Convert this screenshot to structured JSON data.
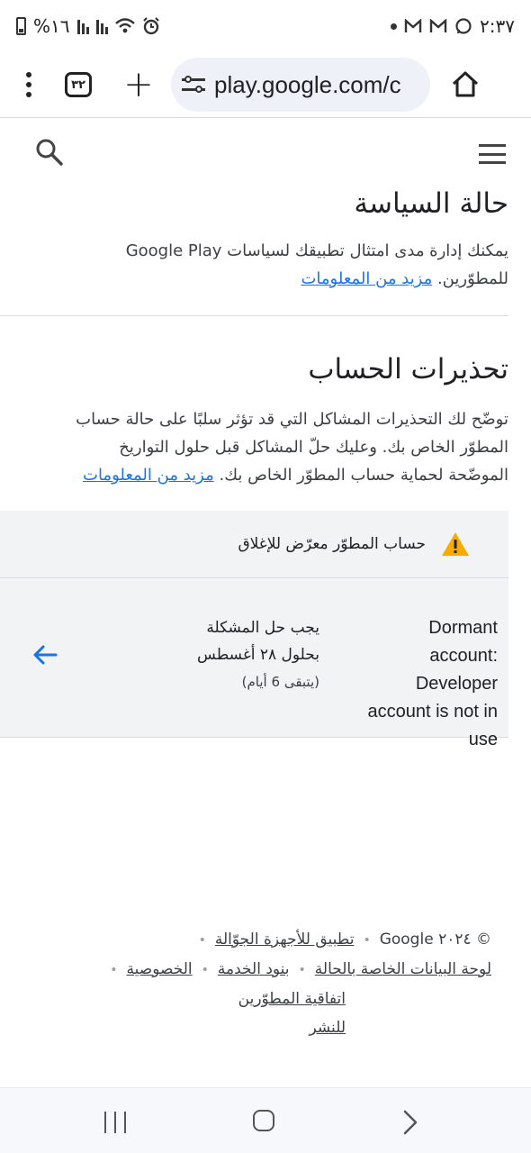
{
  "status_bar": {
    "time": "٢:٣٧",
    "battery": "%١٦",
    "notification_icons": [
      "gmail-icon",
      "gmail-icon",
      "whatsapp-icon"
    ]
  },
  "browser": {
    "url": "play.google.com/c",
    "tab_count": "٣٢"
  },
  "policy": {
    "title": "حالة السياسة",
    "desc_line1": "يمكنك إدارة مدى امتثال تطبيقك لسياسات Google Play",
    "desc_line2_text": "للمطوّرين.",
    "learn_more": "مزيد من المعلومات"
  },
  "warnings": {
    "title": "تحذيرات الحساب",
    "desc_line1": "توضّح لك التحذيرات المشاكل التي قد تؤثر سلبًا على حالة حساب",
    "desc_line2": "المطوّر الخاص بك. وعليك حلّ المشاكل قبل حلول التواريخ",
    "desc_line3_text": "الموضّحة لحماية حساب المطوّر الخاص بك.",
    "learn_more": "مزيد من المعلومات"
  },
  "banner": {
    "text": "حساب المطوّر معرّض للإغلاق",
    "colors": {
      "warning": "#f9ab00"
    }
  },
  "issue_row": {
    "status_lines": [
      "Dormant",
      "account:",
      "Developer",
      "account is not in",
      "use"
    ],
    "deadline_line1": "يجب حل المشكلة",
    "deadline_line2": "بحلول ٢٨ أغسطس",
    "remaining": "(يتبقى 6 أيام)",
    "accent": "#1a73e8"
  },
  "footer": {
    "copyright": "© ٢٠٢٤ Google",
    "links": {
      "mobile_app": "تطبيق للأجهزة الجوّالة",
      "status_dashboard": "لوحة البيانات الخاصة بالحالة",
      "terms": "بنود الخدمة",
      "privacy": "الخصوصية",
      "dda_line1": "اتفاقية المطوّرين",
      "dda_line2": "للنشر"
    }
  }
}
